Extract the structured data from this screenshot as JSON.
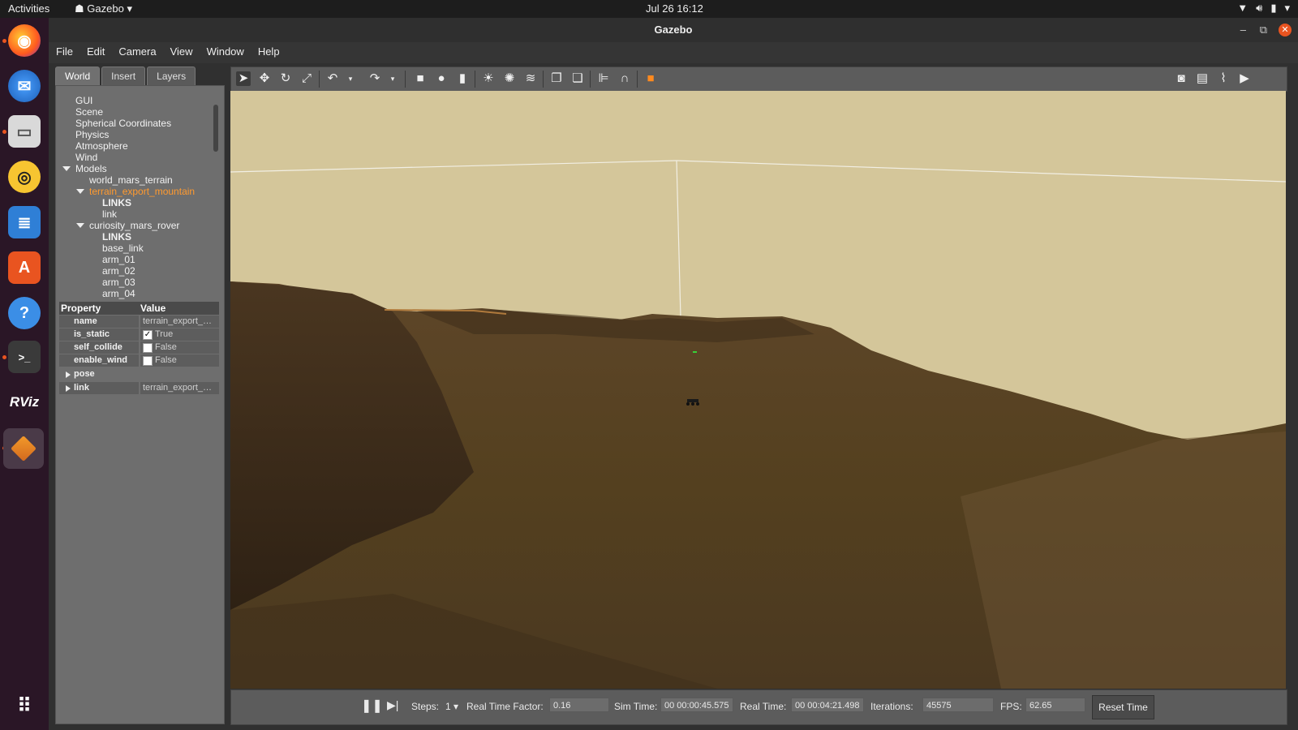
{
  "topbar": {
    "activities": "Activities",
    "app_name": "Gazebo",
    "clock": "Jul 26  16:12"
  },
  "dock": {
    "icons": [
      "firefox-icon",
      "thunderbird-icon",
      "files-icon",
      "rhythmbox-icon",
      "writer-icon",
      "app-center-icon",
      "help-icon",
      "terminal-icon",
      "rviz-icon",
      "gazebo-icon",
      "show-apps-icon"
    ],
    "rviz_label": "RViz"
  },
  "window": {
    "title": "Gazebo",
    "minimize": "–",
    "maximize": "⧉",
    "close": "✕"
  },
  "menu": {
    "file": "File",
    "edit": "Edit",
    "camera": "Camera",
    "view": "View",
    "window": "Window",
    "help": "Help"
  },
  "tabs": {
    "world": "World",
    "insert": "Insert",
    "layers": "Layers"
  },
  "tree": {
    "gui": "GUI",
    "scene": "Scene",
    "spherical": "Spherical Coordinates",
    "physics": "Physics",
    "atmosphere": "Atmosphere",
    "wind": "Wind",
    "models": "Models",
    "world_mars_terrain": "world_mars_terrain",
    "terrain_export_mountain": "terrain_export_mountain",
    "links_1": "LINKS",
    "link": "link",
    "curiosity_mars_rover": "curiosity_mars_rover",
    "links_2": "LINKS",
    "base_link": "base_link",
    "arm_01": "arm_01",
    "arm_02": "arm_02",
    "arm_03": "arm_03",
    "arm_04": "arm_04"
  },
  "properties": {
    "header_property": "Property",
    "header_value": "Value",
    "name_key": "name",
    "name_val": "terrain_export_mountain",
    "is_static_key": "is_static",
    "is_static_val": "True",
    "self_collide_key": "self_collide",
    "self_collide_val": "False",
    "enable_wind_key": "enable_wind",
    "enable_wind_val": "False",
    "pose_key": "pose",
    "link_key": "link",
    "link_val": "terrain_export_mountain"
  },
  "bottombar": {
    "steps_label": "Steps:",
    "steps_val": "1",
    "rtf_label": "Real Time Factor:",
    "rtf_val": "0.16",
    "sim_label": "Sim Time:",
    "sim_val": "00 00:00:45.575",
    "real_label": "Real Time:",
    "real_val": "00 00:04:21.498",
    "iter_label": "Iterations:",
    "iter_val": "45575",
    "fps_label": "FPS:",
    "fps_val": "62.65",
    "reset": "Reset Time"
  },
  "colors": {
    "accent": "#e95420",
    "selected_model": "#ff9a2f",
    "sky": "#d4c69a",
    "terrain": "#5a4326"
  }
}
